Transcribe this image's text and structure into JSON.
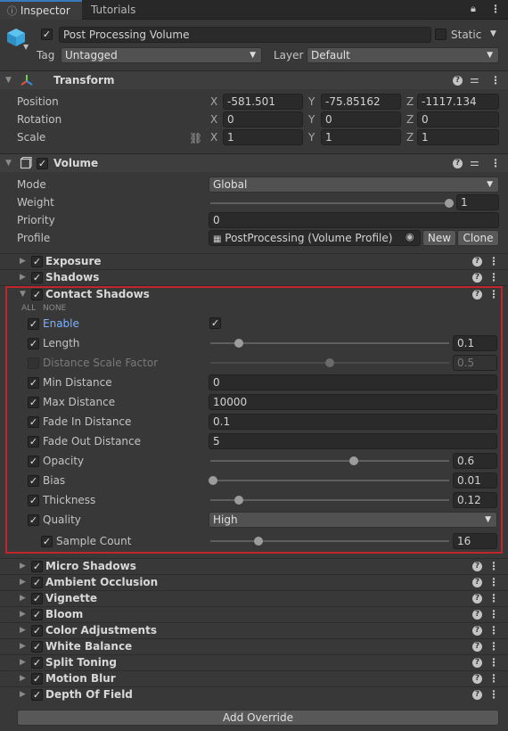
{
  "tabs": {
    "inspector": "Inspector",
    "tutorials": "Tutorials"
  },
  "object": {
    "name": "Post Processing Volume",
    "static_label": "Static",
    "tag_label": "Tag",
    "tag_value": "Untagged",
    "layer_label": "Layer",
    "layer_value": "Default"
  },
  "transform": {
    "title": "Transform",
    "rows": [
      {
        "label": "Position",
        "x": "-581.501",
        "y": "-75.85162",
        "z": "-1117.134"
      },
      {
        "label": "Rotation",
        "x": "0",
        "y": "0",
        "z": "0"
      },
      {
        "label": "Scale",
        "x": "1",
        "y": "1",
        "z": "1"
      }
    ],
    "axis": {
      "x": "X",
      "y": "Y",
      "z": "Z"
    }
  },
  "volume": {
    "title": "Volume",
    "mode_label": "Mode",
    "mode_value": "Global",
    "weight_label": "Weight",
    "weight_value": "1",
    "weight_fraction": 1.0,
    "priority_label": "Priority",
    "priority_value": "0",
    "profile_label": "Profile",
    "profile_value": "PostProcessing (Volume Profile)",
    "new_label": "New",
    "clone_label": "Clone"
  },
  "overrides_top": [
    {
      "label": "Exposure"
    },
    {
      "label": "Shadows"
    }
  ],
  "contact_shadows": {
    "title": "Contact Shadows",
    "all_label": "ALL",
    "none_label": "NONE",
    "enable_label": "Enable",
    "length_label": "Length",
    "length_value": "0.1",
    "length_fraction": 0.12,
    "dsf_label": "Distance Scale Factor",
    "dsf_value": "0.5",
    "dsf_fraction": 0.5,
    "min_distance_label": "Min Distance",
    "min_distance_value": "0",
    "max_distance_label": "Max Distance",
    "max_distance_value": "10000",
    "fade_in_label": "Fade In Distance",
    "fade_in_value": "0.1",
    "fade_out_label": "Fade Out Distance",
    "fade_out_value": "5",
    "opacity_label": "Opacity",
    "opacity_value": "0.6",
    "opacity_fraction": 0.6,
    "bias_label": "Bias",
    "bias_value": "0.01",
    "bias_fraction": 0.01,
    "thickness_label": "Thickness",
    "thickness_value": "0.12",
    "thickness_fraction": 0.12,
    "quality_label": "Quality",
    "quality_value": "High",
    "sample_count_label": "Sample Count",
    "sample_count_value": "16",
    "sample_count_fraction": 0.2
  },
  "overrides_bottom": [
    {
      "label": "Micro Shadows"
    },
    {
      "label": "Ambient Occlusion"
    },
    {
      "label": "Vignette"
    },
    {
      "label": "Bloom"
    },
    {
      "label": "Color Adjustments"
    },
    {
      "label": "White Balance"
    },
    {
      "label": "Split Toning"
    },
    {
      "label": "Motion Blur"
    },
    {
      "label": "Depth Of Field"
    }
  ],
  "add_override_label": "Add Override",
  "colors": {
    "accent": "#3a79bb",
    "highlight_border": "#c0262b",
    "enable_text": "#7cb1ff"
  }
}
